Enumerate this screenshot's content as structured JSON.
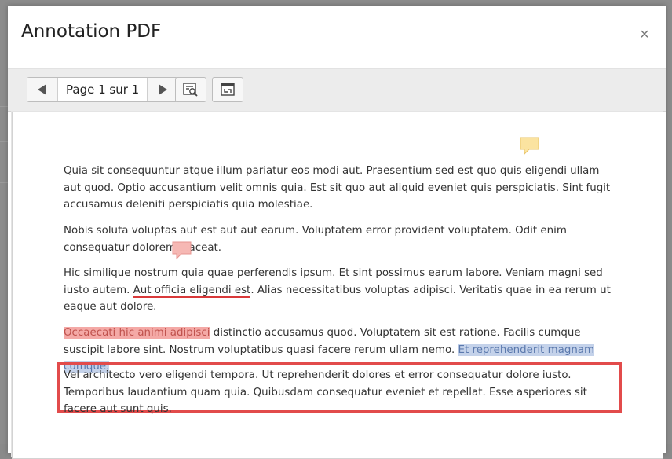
{
  "dialog": {
    "title": "Annotation PDF",
    "close_label": "×"
  },
  "toolbar": {
    "prev_icon": "triangle-left-icon",
    "page_label": "Page 1 sur 1",
    "next_icon": "triangle-right-icon",
    "tool1_icon": "search-annotations-icon",
    "tool2_icon": "fit-page-icon"
  },
  "document": {
    "p1": "Quia sit consequuntur atque illum pariatur eos modi aut.  Praesentium sed est quo quis eligendi ullam aut quod. Optio accusantium  velit omnis quia. Est sit quo aut aliquid eveniet quis perspiciatis.  Sint fugit accusamus deleniti perspiciatis quia molestiae.",
    "p2": "Nobis soluta voluptas aut est aut aut earum. Voluptatem error provident voluptatem. Odit enim consequatur dolorem placeat.",
    "p3_a": "Hic similique nostrum quia quae perferendis ipsum. Et sint  possimus earum labore. Veniam magni sed iusto autem. ",
    "p3_underlined": "Aut officia  eligendi est",
    "p3_b": ". Alias necessitatibus voluptas adipisci. Veritatis quae in  ea rerum ut eaque aut dolore.",
    "p4_highlight_red": "Occaecati hic animi adipisci",
    "p4_mid": " distinctio accusamus quod.  Voluptatem sit est ratione. Facilis cumque suscipit labore sint. Nostrum voluptatibus quasi facere rerum ullam nemo. ",
    "p4_highlight_blue": "Et reprehenderit magnam  cumque.",
    "p5": "Vel architecto vero eligendi tempora. Ut reprehenderit dolores  et error consequatur dolore iusto. Temporibus laudantium quam quia.  Quibusdam consequatur eveniet et repellat. Esse asperiores sit facere  aut sunt quis."
  },
  "annotations": {
    "note_yellow_icon": "comment-yellow-icon",
    "note_pink_icon": "comment-pink-icon",
    "highlight_red_color": "#f4a9a6",
    "highlight_blue_color": "#c4d2ea",
    "underline_color": "#d9393a",
    "box_color": "#e24b4b"
  }
}
